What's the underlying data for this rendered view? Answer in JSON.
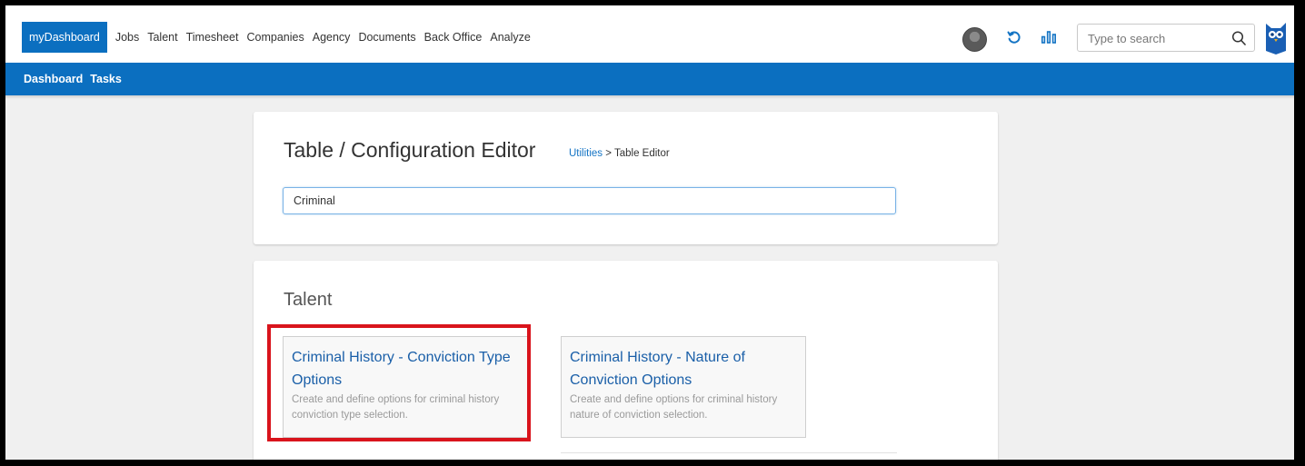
{
  "topnav": {
    "items": [
      {
        "label": "myDashboard",
        "active": true
      },
      {
        "label": "Jobs"
      },
      {
        "label": "Talent"
      },
      {
        "label": "Timesheet"
      },
      {
        "label": "Companies"
      },
      {
        "label": "Agency"
      },
      {
        "label": "Documents"
      },
      {
        "label": "Back Office"
      },
      {
        "label": "Analyze"
      }
    ],
    "search_placeholder": "Type to search",
    "icons": [
      "user-avatar",
      "refresh-icon",
      "analytics-icon",
      "search-icon",
      "owl-logo"
    ],
    "accent_color": "#0b6fc0"
  },
  "subnav": {
    "items": [
      "Dashboard",
      "Tasks"
    ]
  },
  "editor": {
    "title": "Table / Configuration Editor",
    "breadcrumb_link": "Utilities",
    "breadcrumb_separator": ">",
    "breadcrumb_current": "Table Editor",
    "filter_value": "Criminal"
  },
  "results": {
    "section_title": "Talent",
    "tiles": [
      {
        "title": "Criminal History - Conviction Type Options",
        "description": "Create and define options for criminal history conviction type selection.",
        "highlighted": true
      },
      {
        "title": "Criminal History - Nature of Conviction Options",
        "description": "Create and define options for criminal history nature of conviction selection."
      }
    ]
  }
}
